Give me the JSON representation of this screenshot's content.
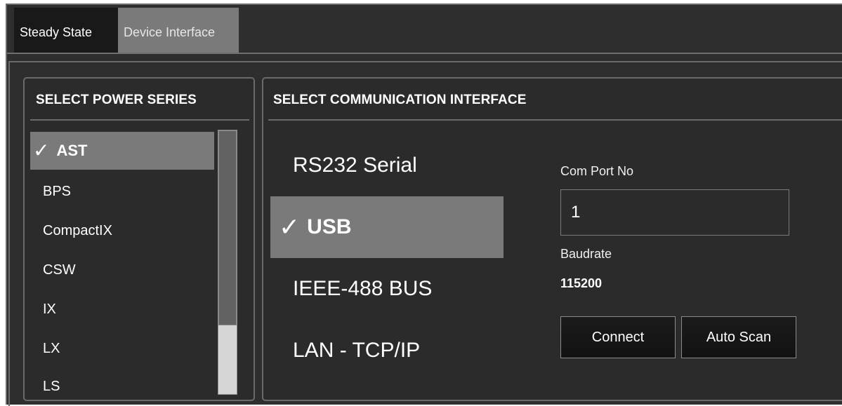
{
  "tabs": [
    {
      "label": "Steady State"
    },
    {
      "label": "Device Interface"
    }
  ],
  "power_series": {
    "title": "SELECT POWER SERIES",
    "items": [
      {
        "label": "AST",
        "selected": true
      },
      {
        "label": "BPS"
      },
      {
        "label": "CompactIX"
      },
      {
        "label": "CSW"
      },
      {
        "label": "IX"
      },
      {
        "label": "LX"
      },
      {
        "label": "LS"
      }
    ]
  },
  "communication": {
    "title": "SELECT COMMUNICATION INTERFACE",
    "interfaces": [
      {
        "label": "RS232 Serial"
      },
      {
        "label": "USB",
        "selected": true
      },
      {
        "label": "IEEE-488 BUS"
      },
      {
        "label": "LAN - TCP/IP"
      }
    ],
    "com_port_label": "Com Port No",
    "com_port_value": "1",
    "baudrate_label": "Baudrate",
    "baudrate_value": "115200",
    "connect_label": "Connect",
    "auto_scan_label": "Auto Scan"
  },
  "icons": {
    "check": "checkmark-icon"
  },
  "colors": {
    "background": "#2e2e2e",
    "selected": "#7a7a7a",
    "border": "#6a6a6a"
  }
}
